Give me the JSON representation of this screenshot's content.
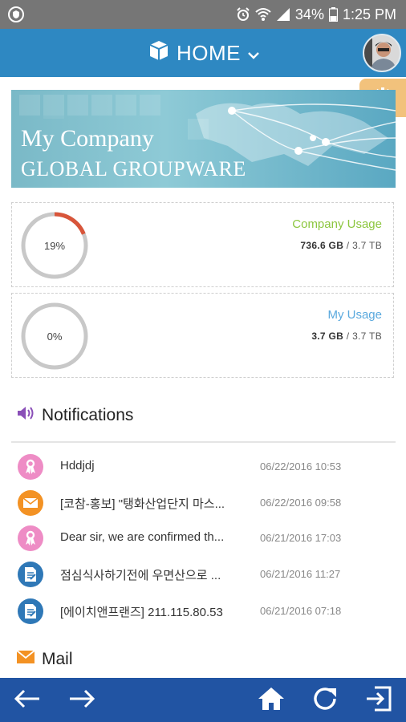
{
  "status_bar": {
    "battery": "34%",
    "time": "1:25 PM",
    "icons": [
      "shield-icon",
      "alarm-icon",
      "wifi-icon",
      "signal-icon",
      "battery-icon"
    ]
  },
  "header": {
    "title": "HOME",
    "icons": [
      "cube-icon",
      "chevron-down-icon"
    ],
    "color": "#2e88c2"
  },
  "banner": {
    "line1": "My Company",
    "line2": "GLOBAL GROUPWARE"
  },
  "usage": {
    "company": {
      "title": "Company Usage",
      "percent_label": "19%",
      "percent": 19,
      "used": "736.6 GB",
      "separator": " / ",
      "total": "3.7 TB",
      "title_color": "#8cc63f"
    },
    "mine": {
      "title": "My Usage",
      "percent_label": "0%",
      "percent": 0,
      "used": "3.7 GB",
      "separator": " / ",
      "total": "3.7 TB",
      "title_color": "#5aa9de"
    }
  },
  "notifications": {
    "heading": "Notifications",
    "items": [
      {
        "title": "Hddjdj",
        "date": "06/22/2016 10:53",
        "icon": "ribbon-icon",
        "color": "#ee8cc5"
      },
      {
        "title": "[코참-홍보] \"탱화산업단지 마스...",
        "date": "06/22/2016 09:58",
        "icon": "envelope-icon",
        "color": "#f39224"
      },
      {
        "title": "Dear sir, we are confirmed th...",
        "date": "06/21/2016 17:03",
        "icon": "ribbon-icon",
        "color": "#ee8cc5"
      },
      {
        "title": "점심식사하기전에 우면산으로 ...",
        "date": "06/21/2016 11:27",
        "icon": "document-icon",
        "color": "#2f78b7"
      },
      {
        "title": "[에이치앤프랜즈] 211.115.80.53",
        "date": "06/21/2016 07:18",
        "icon": "document-icon",
        "color": "#2f78b7"
      }
    ]
  },
  "mail": {
    "heading": "Mail"
  },
  "bottom_nav": {
    "buttons": [
      "back-arrow-icon",
      "forward-arrow-icon",
      "home-icon",
      "refresh-icon",
      "logout-icon"
    ],
    "color": "#2154a3"
  }
}
